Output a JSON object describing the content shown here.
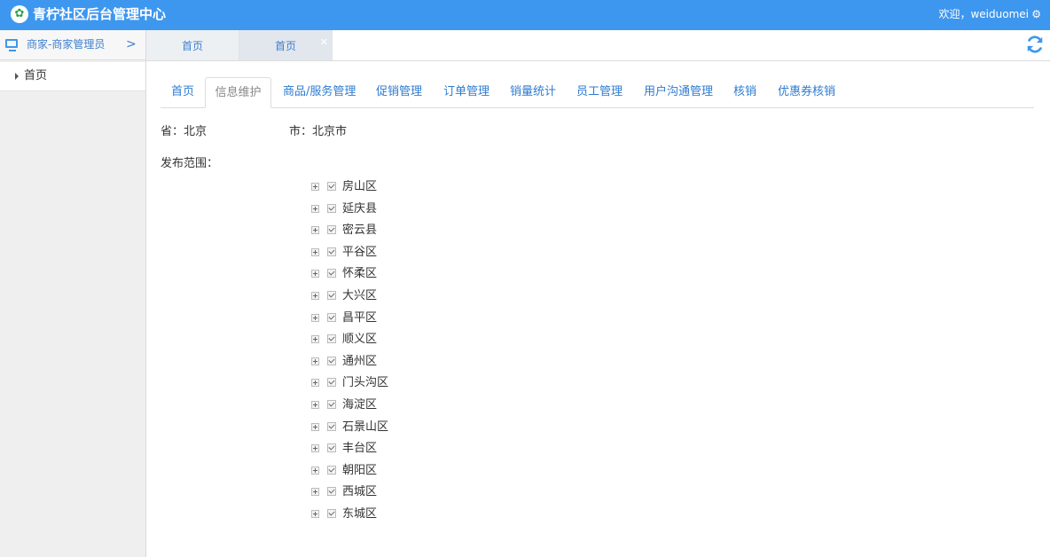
{
  "header": {
    "title": "青柠社区后台管理中心",
    "welcome": "欢迎，weiduomei"
  },
  "sidebar": {
    "role": "商家-商家管理员",
    "items": [
      {
        "label": "首页"
      }
    ]
  },
  "page_tabs": [
    {
      "label": "首页"
    },
    {
      "label": "首页"
    }
  ],
  "nav_tabs": [
    {
      "label": "首页"
    },
    {
      "label": "信息维护",
      "active": true
    },
    {
      "label": "商品/服务管理"
    },
    {
      "label": "促销管理"
    },
    {
      "label": "订单管理"
    },
    {
      "label": "销量统计"
    },
    {
      "label": "员工管理"
    },
    {
      "label": "用户沟通管理"
    },
    {
      "label": "核销"
    },
    {
      "label": "优惠券核销"
    }
  ],
  "form": {
    "province": "省：北京",
    "city": "市：北京市",
    "scope_label": "发布范围："
  },
  "districts": [
    "房山区",
    "延庆县",
    "密云县",
    "平谷区",
    "怀柔区",
    "大兴区",
    "昌平区",
    "顺义区",
    "通州区",
    "门头沟区",
    "海淀区",
    "石景山区",
    "丰台区",
    "朝阳区",
    "西城区",
    "东城区"
  ],
  "colors": {
    "brand": "#3e97ee",
    "link": "#2e7bd1"
  }
}
